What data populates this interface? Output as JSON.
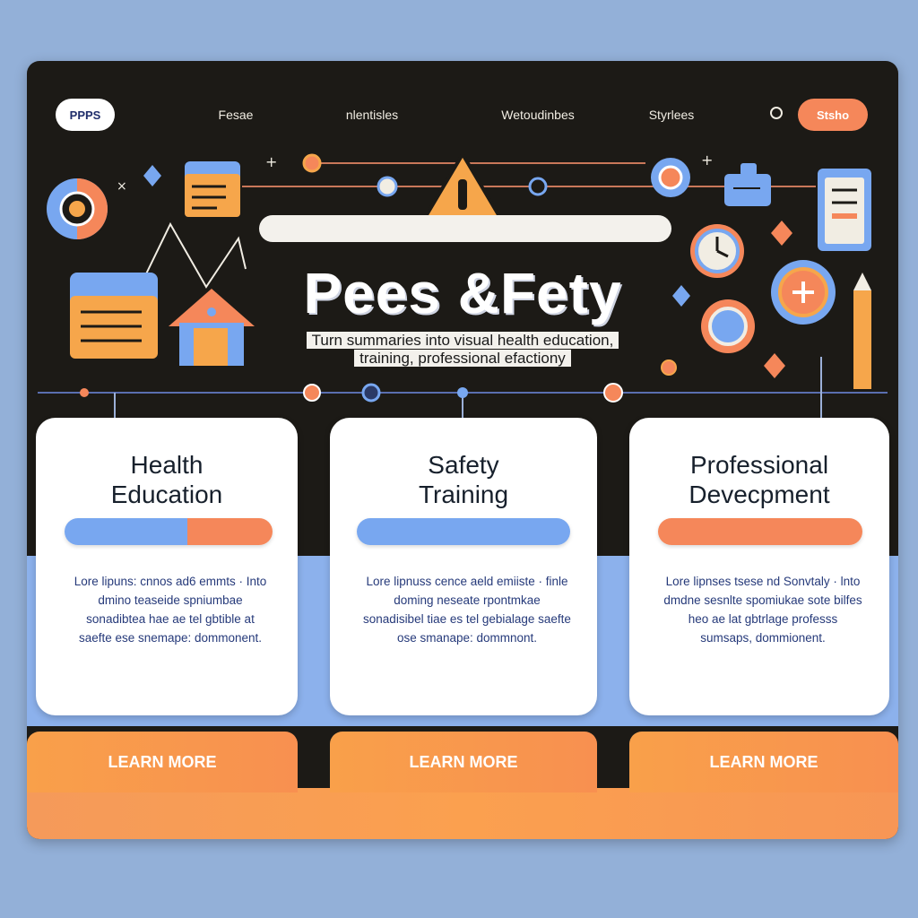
{
  "nav": {
    "logo": "PPPS",
    "links": [
      "Fesae",
      "nlentisles",
      "Wetoudinbes",
      "Styrlees"
    ],
    "cta": "Stsho"
  },
  "hero": {
    "title": "Pees &Fety",
    "subtitle_line1": "Turn summaries into visual health education,",
    "subtitle_line2": "training, professional efactiony"
  },
  "cards": [
    {
      "title": "Health\nEducation",
      "text": "Lore lipuns: cnnos ad6 emmts · Into dmino teaseide spniumbae sonadibtea hae ae tel gbtible at saefte ese snemape: dommonent.",
      "bar_colors": [
        "#78a7f0",
        "#f5875a"
      ],
      "bar_split": 0.59,
      "button": "LEARN MORE"
    },
    {
      "title": "Safety\nTraining",
      "text": "Lore lipnuss cence aeld emiiste · finle doming neseate rpontmkae sonadisibel tiae es tel gebialage saefte ose smanape: dommnont.",
      "bar_colors": [
        "#78a7f0",
        "#78a7f0"
      ],
      "bar_split": 1.0,
      "button": "LEARN MORE"
    },
    {
      "title": "Professional\nDevecpment",
      "text": "Lore lipnses tsese nd Sonvtaly · lnto dmdne sesnlte spomiukae sote bilfes heo ae lat gbtrlage professs sumsaps, dommionent.",
      "bar_colors": [
        "#f5875a",
        "#f5875a"
      ],
      "bar_split": 1.0,
      "button": "LEARN MORE"
    }
  ],
  "colors": {
    "frame_bg": "#1c1a16",
    "accent_orange": "#f5875a",
    "accent_blue": "#78a7f0",
    "warning_yellow": "#f6a64b"
  }
}
